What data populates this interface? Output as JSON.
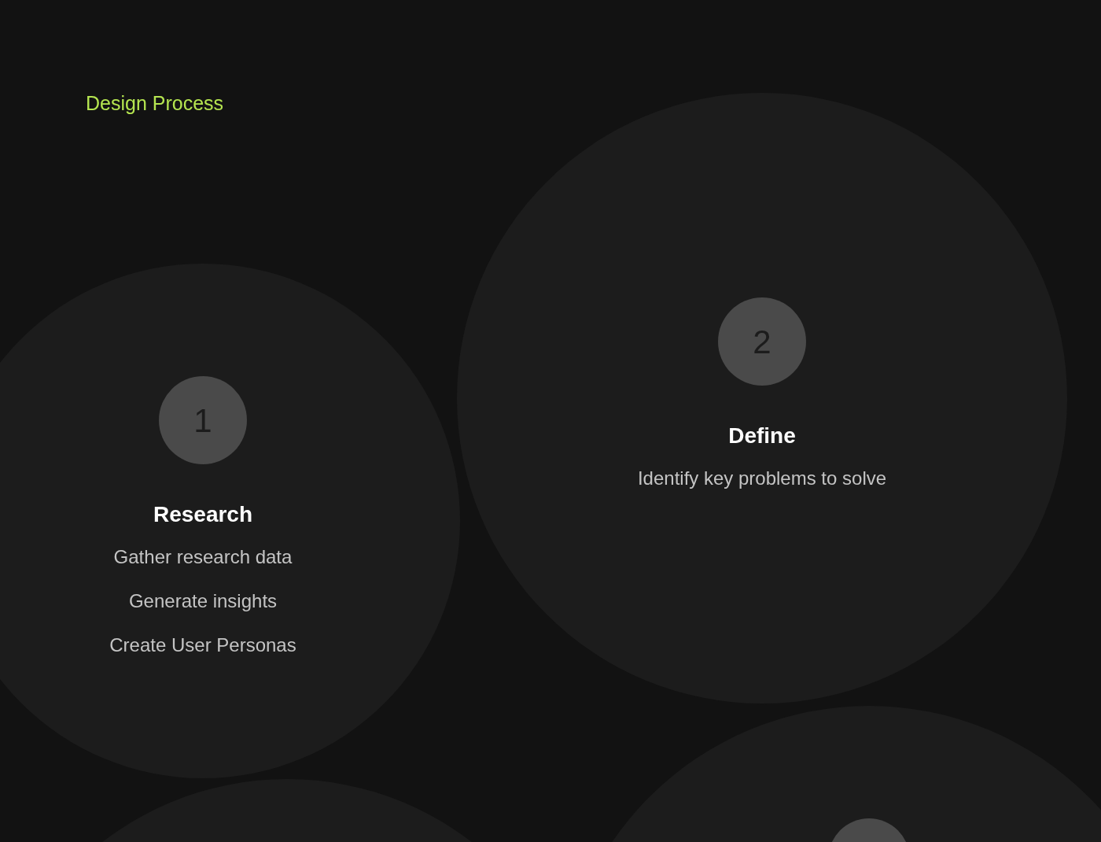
{
  "heading": "Design Process",
  "steps": [
    {
      "number": "1",
      "title": "Research",
      "items": [
        "Gather research data",
        "Generate insights",
        "Create User Personas"
      ]
    },
    {
      "number": "2",
      "title": "Define",
      "items": [
        "Identify key problems to solve"
      ]
    }
  ]
}
